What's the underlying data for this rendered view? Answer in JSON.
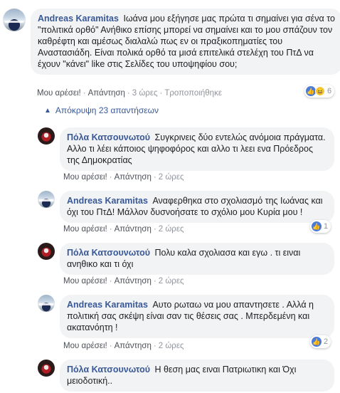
{
  "comments": [
    {
      "author": "Andreas Karamitas",
      "text": "Ιωάνα μου εξήγησε μας πρώτα τι σημαίνει για σένα το \"πολιτικά ορθό\" Ανήθικο επίσης μπορεί να σημαίνει και το μου σπάζουν τον καθρέφτη και αμέσως διαλαλώ πως εν οι πραξικοπηματίες του Αναστασιάδη. Είναι πολικά ορθό τα μισά επιτελικά στελέχη του ΠτΔ να έχουν \"κάνει\" like στις Σελίδες του υποψηφίου σου;",
      "like_label": "Μου αρέσει!",
      "reply_label": "Απάντηση",
      "time": "3 ώρες",
      "edited_label": "Τροποποιήθηκε",
      "reactions": [
        "like-icon",
        "haha-icon"
      ],
      "reaction_count": "6"
    }
  ],
  "toggle_label": "Απόκρυψη 23 απαντήσεων",
  "replies": [
    {
      "author": "Πόλα Κατσουνωτού",
      "text": "Συγκρινεις δύο εντελώς ανόμοια πράγματα. Αλλο τι λέει κάποιος ψηφοφόρος και αλλο τι λεει ενα Πρόεδρος της Δημοκρατίας",
      "like_label": "Μου αρέσει!",
      "reply_label": "Απάντηση",
      "time": "2 ώρες"
    },
    {
      "author": "Andreas Karamitas",
      "text": "Αναφερθηκα στο σχολιασμό της Ιωάνας και όχι του ΠτΔ! Μάλλον δυσνοήσατε το σχόλιο μου Κυρία μου !",
      "like_label": "Μου αρέσει!",
      "reply_label": "Απάντηση",
      "time": "2 ώρες",
      "reaction_count": "1"
    },
    {
      "author": "Πόλα Κατσουνωτού",
      "text": "Πολυ καλα σχολιασα και εγω . τι ειναι ανηθικο και τι όχι",
      "like_label": "Μου αρέσει!",
      "reply_label": "Απάντηση",
      "time": "2 ώρες"
    },
    {
      "author": "Andreas Karamitas",
      "text": "Αυτο ρωταω να μου απαντησετε . Αλλά η πολιτική σας σκέψη είναι σαν τις θέσεις σας . Μπερδεμένη και ακατανόητη !",
      "like_label": "Μου αρέσει!",
      "reply_label": "Απάντηση",
      "time": "2 ώρες",
      "reaction_count": "2"
    },
    {
      "author": "Πόλα Κατσουνωτού",
      "text": "Η θεση μας ειναι Πατριωτικη και Όχι μειοδοτική..",
      "like_label": "",
      "reply_label": "",
      "time": ""
    }
  ],
  "colors": {
    "author_link": "#385898",
    "bubble_bg": "#f2f3f5",
    "muted_text": "#90949c",
    "like_blue": "#4a7bd8"
  }
}
